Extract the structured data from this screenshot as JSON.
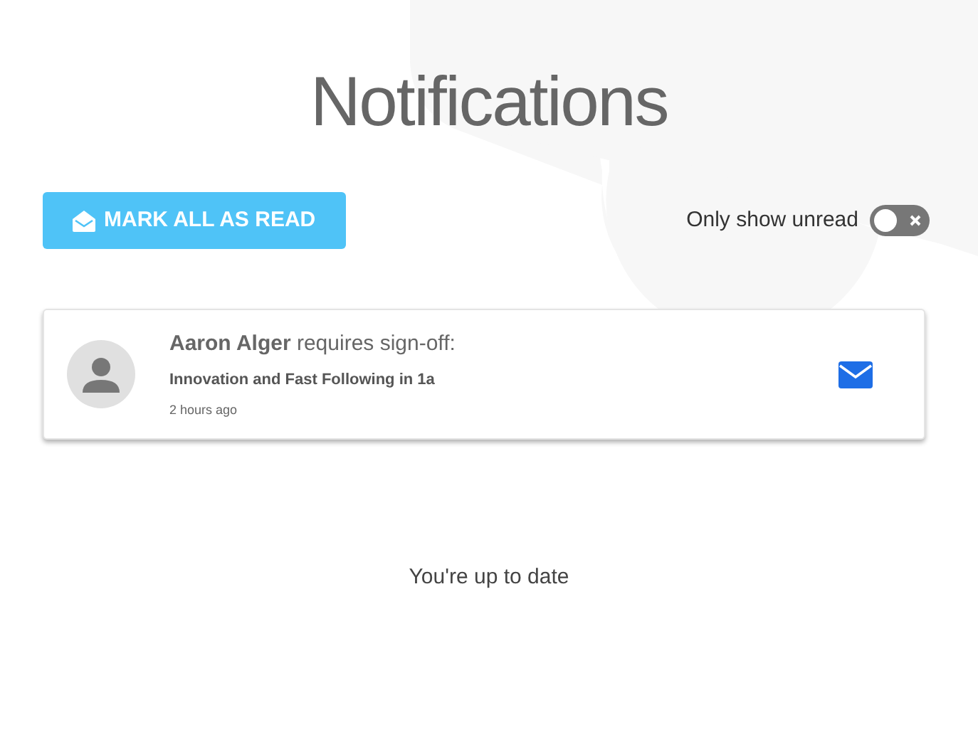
{
  "title": "Notifications",
  "mark_all_button": {
    "label": "MARK ALL AS READ"
  },
  "filter": {
    "label": "Only show unread",
    "on": false
  },
  "notifications": [
    {
      "sender": "Aaron Alger",
      "action": "requires sign-off:",
      "subject": "Innovation and Fast Following in 1a",
      "time": "2 hours ago",
      "unread": true
    }
  ],
  "footer": "You're up to date"
}
